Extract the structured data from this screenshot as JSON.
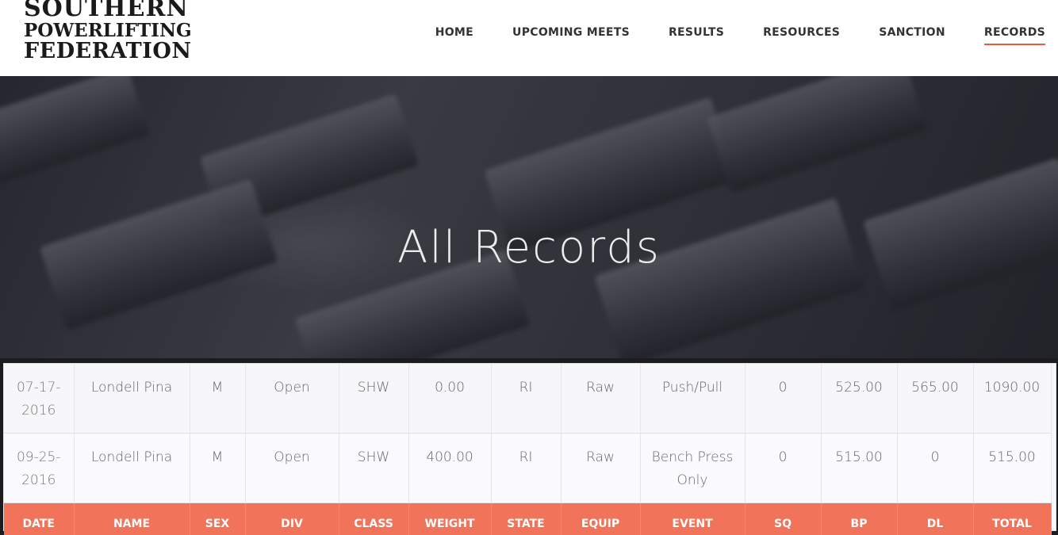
{
  "site": {
    "logo_line1": "Southern",
    "logo_line2": "Powerlifting",
    "logo_line3": "Federation"
  },
  "nav": {
    "items": [
      "HOME",
      "UPCOMING MEETS",
      "RESULTS",
      "RESOURCES",
      "SANCTION",
      "RECORDS"
    ],
    "active": "RECORDS"
  },
  "hero": {
    "title": "All Records"
  },
  "table": {
    "columns": [
      "DATE",
      "NAME",
      "SEX",
      "DIV",
      "CLASS",
      "WEIGHT",
      "STATE",
      "EQUIP",
      "EVENT",
      "SQ",
      "BP",
      "DL",
      "TOTAL"
    ],
    "rows": [
      [
        "07-17-2016",
        "Londell Pina",
        "M",
        "Open",
        "SHW",
        "0.00",
        "RI",
        "Raw",
        "Push/Pull",
        "0",
        "525.00",
        "565.00",
        "1090.00"
      ],
      [
        "09-25-2016",
        "Londell Pina",
        "M",
        "Open",
        "SHW",
        "400.00",
        "RI",
        "Raw",
        "Bench Press Only",
        "0",
        "515.00",
        "0",
        "515.00"
      ]
    ]
  },
  "colors": {
    "accent": "#ea5a3a",
    "table_header": "#f0735a"
  }
}
